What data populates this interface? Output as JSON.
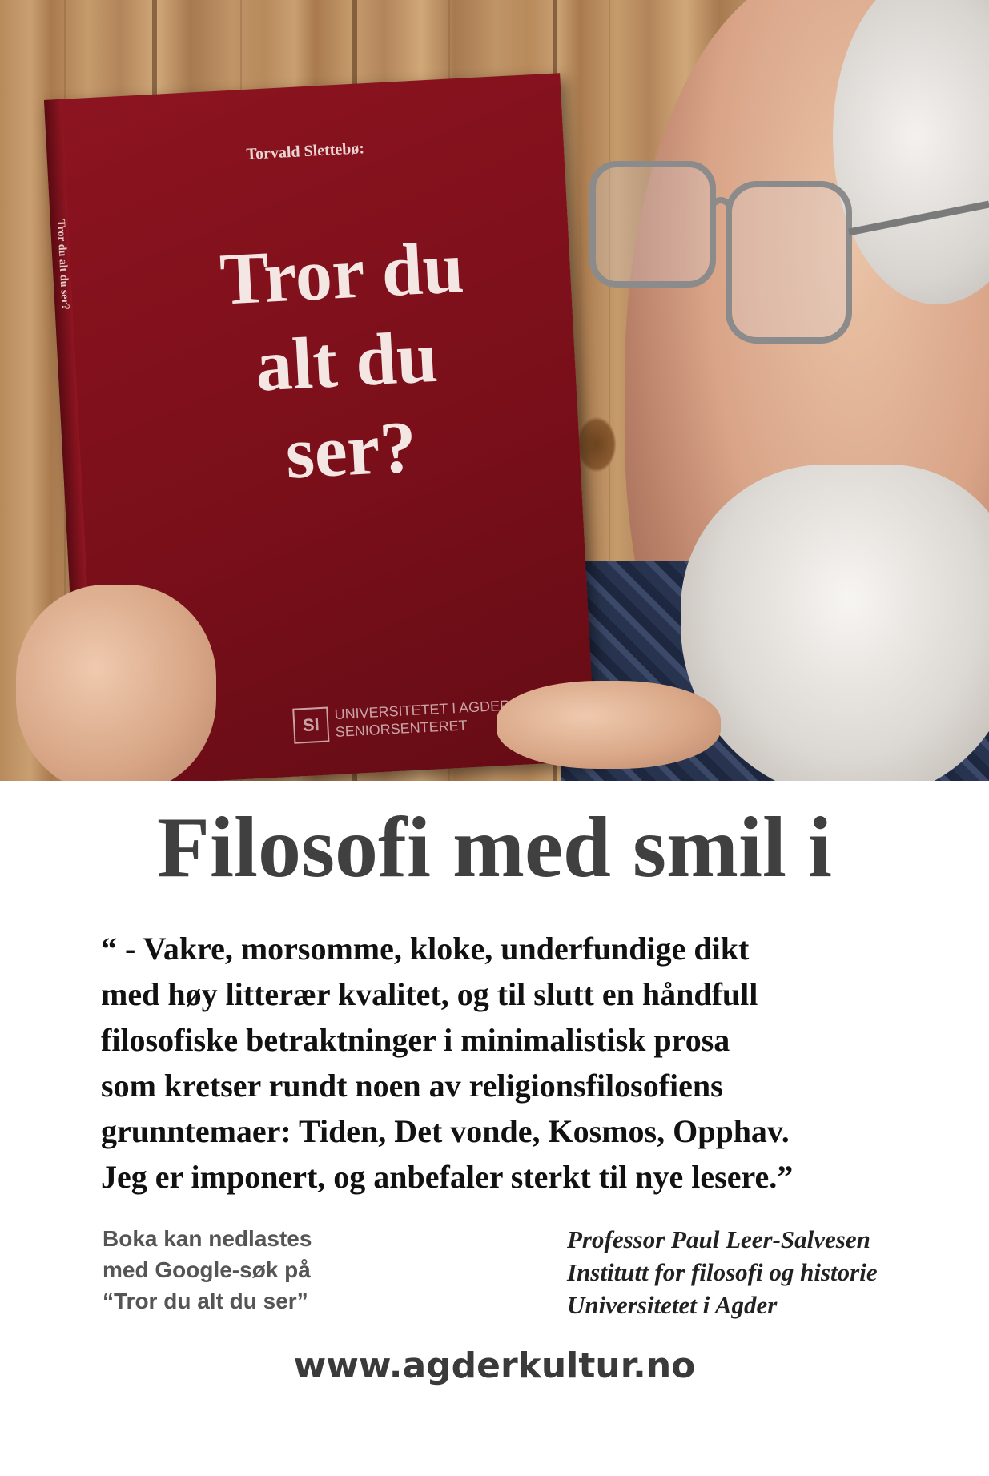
{
  "book": {
    "author": "Torvald Slettebø:",
    "title_lines": [
      "Tror du",
      "alt du",
      "ser?"
    ],
    "spine": "Tror du alt du ser?",
    "logo_mark": "SI",
    "publisher_line1": "UNIVERSITETET I AGDER",
    "publisher_line2": "SENIORSENTERET"
  },
  "headline": "Filosofi med smil i",
  "quote_lines": [
    "“ - Vakre, morsomme, kloke, underfundige dikt",
    "med høy litterær  kvalitet, og til slutt en håndfull",
    "filosofiske betraktninger  i minimalistisk prosa",
    "som kretser rundt noen av religionsfilosofiens",
    "grunntemaer: Tiden, Det vonde, Kosmos, Opphav.",
    "Jeg er imponert, og anbefaler sterkt til nye lesere.”"
  ],
  "download_lines": [
    "Boka kan nedlastes",
    "med Google-søk på",
    "“Tror du alt du ser”"
  ],
  "attribution_lines": [
    "Professor Paul Leer-Salvesen",
    "Institutt for filosofi og historie",
    "Universitetet i Agder"
  ],
  "website": "www.agderkultur.no",
  "colors": {
    "book_red": "#7a0f1a",
    "headline": "#404040",
    "wood": "#c9a072"
  }
}
